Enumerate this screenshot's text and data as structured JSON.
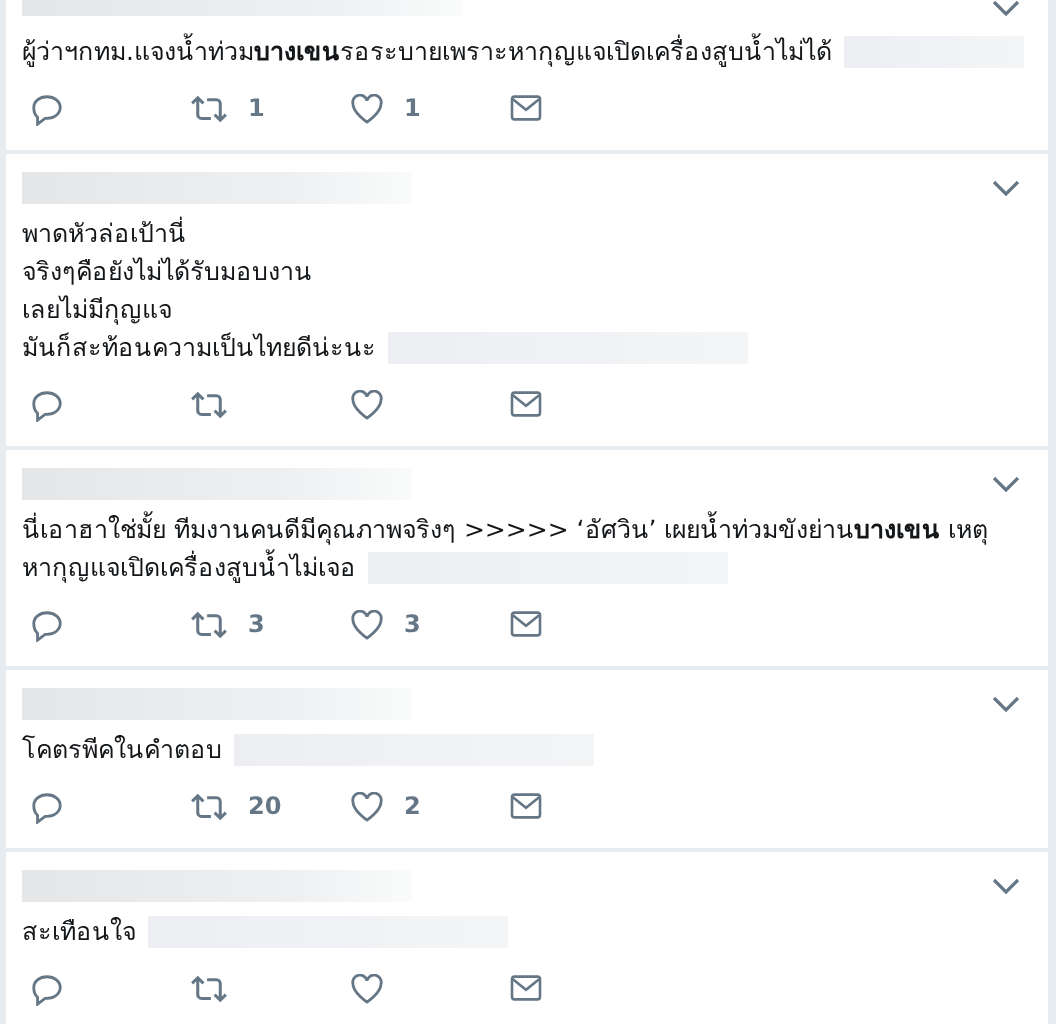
{
  "tweets": [
    {
      "lines": [
        "ผู้ว่าฯกทม.แจงน้ำท่วม**บางเขน**รอระบายเพราะหากุญแจเปิดเครื่องสูบน้ำไม่ได้"
      ],
      "retweets": "1",
      "likes": "1"
    },
    {
      "lines": [
        "พาดหัวล่อเป้านี่",
        "จริงๆคือยังไม่ได้รับมอบงาน",
        "เลยไม่มีกุญแจ",
        "มันก็สะท้อนความเป็นไทยดีน่ะนะ"
      ]
    },
    {
      "lines": [
        "นี่เอาฮาใช่มั้ย ทีมงานคนดีมีคุณภาพจริงๆ >>>>> ‘อัศวิน’ เผยน้ำท่วมขังย่าน**บางเขน** เหตุ",
        "หากุญแจเปิดเครื่องสูบน้ำไม่เจอ"
      ],
      "retweets": "3",
      "likes": "3"
    },
    {
      "lines": [
        "โคตรพีคในคำตอบ"
      ],
      "retweets": "20",
      "likes": "2"
    },
    {
      "lines": [
        "สะเทือนใจ"
      ]
    }
  ]
}
